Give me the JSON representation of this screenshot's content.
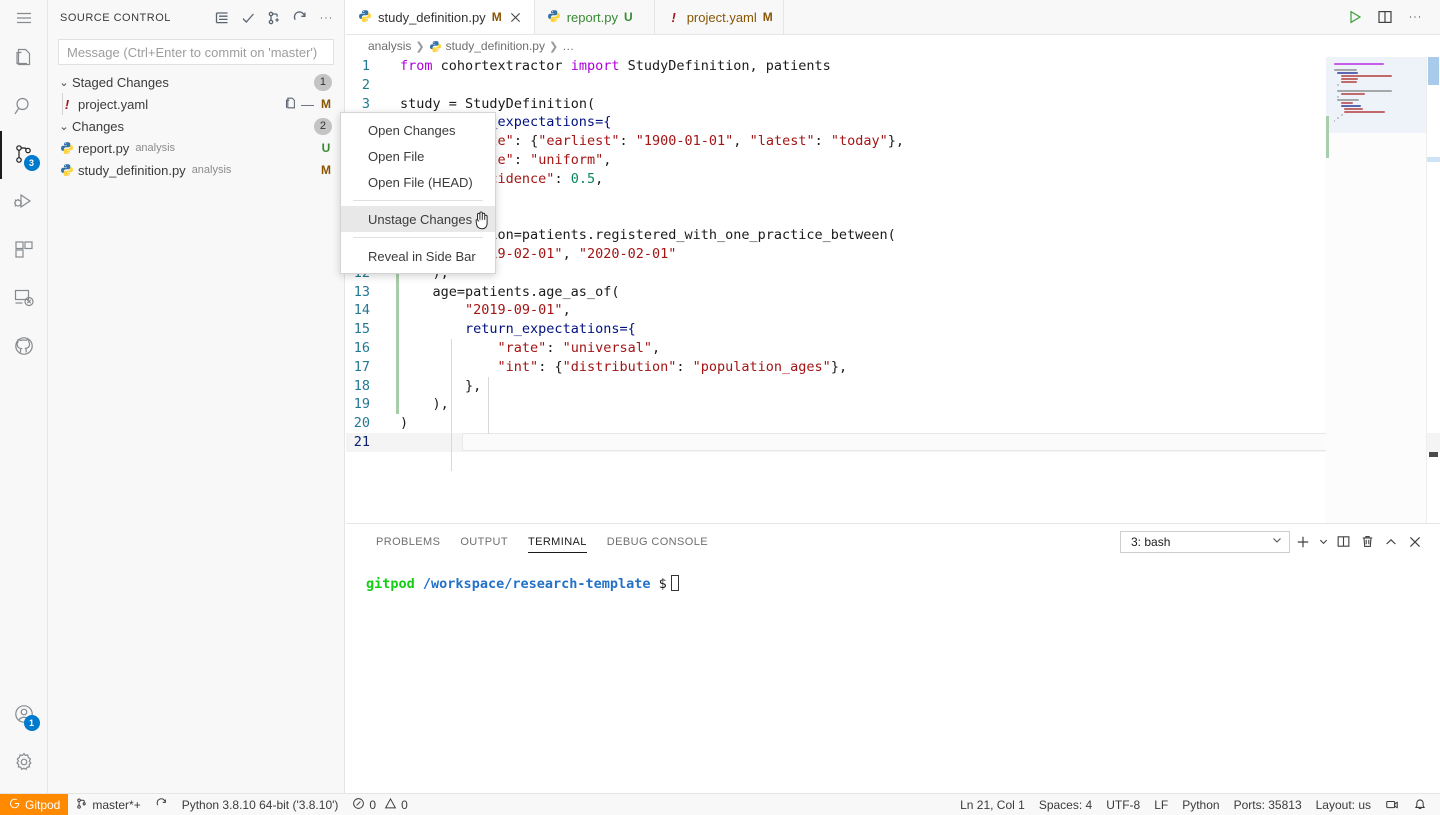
{
  "activitybar": {
    "menu_label": "hamburger-menu",
    "items": [
      {
        "name": "explorer",
        "icon": "files-icon",
        "badge": null,
        "active": false
      },
      {
        "name": "search",
        "icon": "search-icon",
        "badge": null,
        "active": false
      },
      {
        "name": "source-control",
        "icon": "source-control-icon",
        "badge": "3",
        "active": true
      },
      {
        "name": "run-and-debug",
        "icon": "run-debug-icon",
        "badge": null,
        "active": false
      },
      {
        "name": "extensions",
        "icon": "extensions-icon",
        "badge": null,
        "active": false
      },
      {
        "name": "remote-explorer",
        "icon": "remote-explorer-icon",
        "badge": null,
        "active": false
      },
      {
        "name": "github",
        "icon": "github-icon",
        "badge": null,
        "active": false
      }
    ],
    "bottom_items": [
      {
        "name": "accounts",
        "icon": "account-icon",
        "badge": "1"
      },
      {
        "name": "manage",
        "icon": "gear-icon",
        "badge": null
      }
    ]
  },
  "sidebar": {
    "title": "SOURCE CONTROL",
    "actions": [
      {
        "name": "view-as-list",
        "icon": "list-icon"
      },
      {
        "name": "commit",
        "icon": "check-icon"
      },
      {
        "name": "more-branch",
        "icon": "branch-plus-icon"
      },
      {
        "name": "refresh",
        "icon": "refresh-icon"
      },
      {
        "name": "views-and-more-actions",
        "icon": "ellipsis-icon"
      }
    ],
    "commit_input_placeholder": "Message (Ctrl+Enter to commit on 'master')",
    "groups": [
      {
        "name": "Staged Changes",
        "count": "1",
        "files": [
          {
            "filename": "project.yaml",
            "folder": "",
            "status": "M",
            "status_class": "M",
            "icon": "yaml-warning-icon",
            "inline_actions": [
              "unstage-icon",
              "dash-icon"
            ]
          }
        ]
      },
      {
        "name": "Changes",
        "count": "2",
        "files": [
          {
            "filename": "report.py",
            "folder": "analysis",
            "status": "U",
            "status_class": "U",
            "icon": "python-icon",
            "inline_actions": []
          },
          {
            "filename": "study_definition.py",
            "folder": "analysis",
            "status": "M",
            "status_class": "M",
            "icon": "python-icon",
            "inline_actions": []
          }
        ]
      }
    ]
  },
  "context_menu": {
    "items": [
      {
        "label": "Open Changes",
        "selected": false,
        "separator_after": false
      },
      {
        "label": "Open File",
        "selected": false,
        "separator_after": false
      },
      {
        "label": "Open File (HEAD)",
        "selected": false,
        "separator_after": true
      },
      {
        "label": "Unstage Changes",
        "selected": true,
        "separator_after": true
      },
      {
        "label": "Reveal in Side Bar",
        "selected": false,
        "separator_after": false
      }
    ]
  },
  "editor": {
    "tabs": [
      {
        "label": "study_definition.py",
        "status": "M",
        "icon": "python-icon",
        "active": true,
        "closable": true
      },
      {
        "label": "report.py",
        "status": "U",
        "icon": "python-icon",
        "active": false,
        "closable": false
      },
      {
        "label": "project.yaml",
        "status": "M",
        "icon": "yaml-warning-icon",
        "active": false,
        "closable": false
      }
    ],
    "tab_actions": [
      {
        "name": "run-python-file",
        "icon": "play-icon"
      },
      {
        "name": "split-editor",
        "icon": "split-editor-icon"
      },
      {
        "name": "more-actions",
        "icon": "ellipsis-icon"
      }
    ],
    "breadcrumb": [
      "analysis",
      "study_definition.py",
      "…"
    ],
    "lines": [
      {
        "num": "1",
        "tokens": [
          {
            "t": "from ",
            "c": "k"
          },
          {
            "t": "cohortextractor ",
            "c": "id"
          },
          {
            "t": "import ",
            "c": "k"
          },
          {
            "t": "StudyDefinition, patients",
            "c": "id"
          }
        ]
      },
      {
        "num": "2",
        "tokens": []
      },
      {
        "num": "3",
        "tokens": [
          {
            "t": "study ",
            "c": "id"
          },
          {
            "t": "= ",
            "c": "op"
          },
          {
            "t": "StudyDefinition(",
            "c": "id"
          }
        ]
      },
      {
        "num": "4",
        "tokens": [
          {
            "t": "    default_expectations={",
            "c": "var"
          }
        ]
      },
      {
        "num": "5",
        "tokens": [
          {
            "t": "        ",
            "c": "p"
          },
          {
            "t": "\"date\"",
            "c": "s"
          },
          {
            "t": ": {",
            "c": "p"
          },
          {
            "t": "\"earliest\"",
            "c": "s"
          },
          {
            "t": ": ",
            "c": "p"
          },
          {
            "t": "\"1900-01-01\"",
            "c": "s"
          },
          {
            "t": ", ",
            "c": "p"
          },
          {
            "t": "\"latest\"",
            "c": "s"
          },
          {
            "t": ": ",
            "c": "p"
          },
          {
            "t": "\"today\"",
            "c": "s"
          },
          {
            "t": "},",
            "c": "p"
          }
        ]
      },
      {
        "num": "6",
        "tokens": [
          {
            "t": "        ",
            "c": "p"
          },
          {
            "t": "\"rate\"",
            "c": "s"
          },
          {
            "t": ": ",
            "c": "p"
          },
          {
            "t": "\"uniform\"",
            "c": "s"
          },
          {
            "t": ",",
            "c": "p"
          }
        ]
      },
      {
        "num": "7",
        "tokens": [
          {
            "t": "        ",
            "c": "p"
          },
          {
            "t": "\"incidence\"",
            "c": "s"
          },
          {
            "t": ": ",
            "c": "p"
          },
          {
            "t": "0.5",
            "c": "n"
          },
          {
            "t": ",",
            "c": "p"
          }
        ]
      },
      {
        "num": "8",
        "tokens": [
          {
            "t": "    },",
            "c": "p"
          }
        ]
      },
      {
        "num": "9",
        "tokens": [
          {
            "t": "",
            "c": "p"
          }
        ]
      },
      {
        "num": "10",
        "tokens": [
          {
            "t": "    population=patients.registered_with_one_practice_between(",
            "c": "id"
          }
        ]
      },
      {
        "num": "11",
        "tokens": [
          {
            "t": "        ",
            "c": "p"
          },
          {
            "t": "\"2019-02-01\"",
            "c": "s"
          },
          {
            "t": ", ",
            "c": "p"
          },
          {
            "t": "\"2020-02-01\"",
            "c": "s"
          }
        ]
      },
      {
        "num": "12",
        "tokens": [
          {
            "t": "    ),",
            "c": "p"
          }
        ]
      },
      {
        "num": "13",
        "tokens": [
          {
            "t": "    age=patients.age_as_of(",
            "c": "id"
          }
        ]
      },
      {
        "num": "14",
        "tokens": [
          {
            "t": "        ",
            "c": "p"
          },
          {
            "t": "\"2019-09-01\"",
            "c": "s"
          },
          {
            "t": ",",
            "c": "p"
          }
        ]
      },
      {
        "num": "15",
        "tokens": [
          {
            "t": "        ",
            "c": "p"
          },
          {
            "t": "return_expectations={",
            "c": "var"
          }
        ]
      },
      {
        "num": "16",
        "tokens": [
          {
            "t": "            ",
            "c": "p"
          },
          {
            "t": "\"rate\"",
            "c": "s"
          },
          {
            "t": ": ",
            "c": "p"
          },
          {
            "t": "\"universal\"",
            "c": "s"
          },
          {
            "t": ",",
            "c": "p"
          }
        ]
      },
      {
        "num": "17",
        "tokens": [
          {
            "t": "            ",
            "c": "p"
          },
          {
            "t": "\"int\"",
            "c": "s"
          },
          {
            "t": ": {",
            "c": "p"
          },
          {
            "t": "\"distribution\"",
            "c": "s"
          },
          {
            "t": ": ",
            "c": "p"
          },
          {
            "t": "\"population_ages\"",
            "c": "s"
          },
          {
            "t": "},",
            "c": "p"
          }
        ]
      },
      {
        "num": "18",
        "tokens": [
          {
            "t": "        },",
            "c": "p"
          }
        ]
      },
      {
        "num": "19",
        "tokens": [
          {
            "t": "    ),",
            "c": "p"
          }
        ]
      },
      {
        "num": "20",
        "tokens": [
          {
            "t": ")",
            "c": "p"
          }
        ]
      },
      {
        "num": "21",
        "tokens": []
      }
    ]
  },
  "panel": {
    "tabs": [
      {
        "label": "PROBLEMS",
        "active": false
      },
      {
        "label": "OUTPUT",
        "active": false
      },
      {
        "label": "TERMINAL",
        "active": true
      },
      {
        "label": "DEBUG CONSOLE",
        "active": false
      }
    ],
    "terminal_select_value": "3: bash",
    "actions": [
      {
        "name": "new-terminal",
        "icon": "plus-icon"
      },
      {
        "name": "new-terminal-options",
        "icon": "chevron-down-icon"
      },
      {
        "name": "split-terminal",
        "icon": "split-icon"
      },
      {
        "name": "kill-terminal",
        "icon": "trash-icon"
      },
      {
        "name": "maximize-panel",
        "icon": "chevron-up-icon"
      },
      {
        "name": "close-panel",
        "icon": "close-icon"
      }
    ],
    "terminal_prompt_user": "gitpod",
    "terminal_prompt_path": "/workspace/research-template",
    "terminal_prompt_symbol": "$"
  },
  "statusbar": {
    "gitpod_label": "Gitpod",
    "left_items": [
      {
        "name": "branch",
        "label": "master*+",
        "icon": "branch-icon"
      },
      {
        "name": "sync-changes",
        "label": "",
        "icon": "sync-icon"
      },
      {
        "name": "python-interpreter",
        "label": "Python 3.8.10 64-bit ('3.8.10')",
        "icon": ""
      },
      {
        "name": "problems",
        "label": "0  0",
        "icon": "error-warning-icon"
      }
    ],
    "errors_count": "0",
    "warnings_count": "0",
    "right_items": [
      {
        "name": "editor-position",
        "label": "Ln 21, Col 1"
      },
      {
        "name": "indentation",
        "label": "Spaces: 4"
      },
      {
        "name": "encoding",
        "label": "UTF-8"
      },
      {
        "name": "eol",
        "label": "LF"
      },
      {
        "name": "language-mode",
        "label": "Python"
      },
      {
        "name": "ports",
        "label": "Ports: 35813"
      },
      {
        "name": "keyboard-layout",
        "label": "Layout: us"
      }
    ],
    "right_icons": [
      {
        "name": "screencast-icon"
      },
      {
        "name": "bell-icon"
      }
    ]
  },
  "colors": {
    "accent": "#007acc",
    "gitpod_orange": "#ff8a00",
    "modified": "#895503",
    "untracked": "#388a34",
    "keyword": "#af00db",
    "string": "#a31515",
    "number": "#098658",
    "variable": "#001080",
    "linenumber": "#237893"
  }
}
